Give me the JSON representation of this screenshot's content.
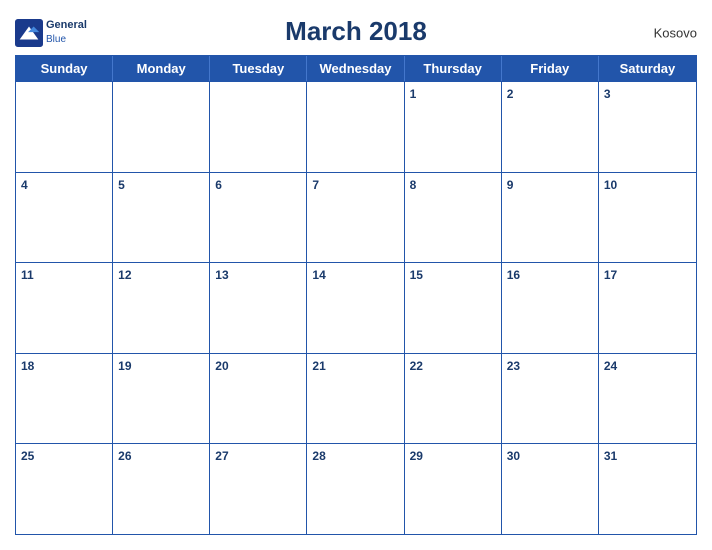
{
  "header": {
    "title": "March 2018",
    "country": "Kosovo",
    "logo": {
      "line1": "General",
      "line2": "Blue"
    }
  },
  "days": {
    "headers": [
      "Sunday",
      "Monday",
      "Tuesday",
      "Wednesday",
      "Thursday",
      "Friday",
      "Saturday"
    ]
  },
  "weeks": [
    [
      {
        "date": "",
        "empty": true
      },
      {
        "date": "",
        "empty": true
      },
      {
        "date": "",
        "empty": true
      },
      {
        "date": "",
        "empty": true
      },
      {
        "date": "1"
      },
      {
        "date": "2"
      },
      {
        "date": "3"
      }
    ],
    [
      {
        "date": "4"
      },
      {
        "date": "5"
      },
      {
        "date": "6"
      },
      {
        "date": "7"
      },
      {
        "date": "8"
      },
      {
        "date": "9"
      },
      {
        "date": "10"
      }
    ],
    [
      {
        "date": "11"
      },
      {
        "date": "12"
      },
      {
        "date": "13"
      },
      {
        "date": "14"
      },
      {
        "date": "15"
      },
      {
        "date": "16"
      },
      {
        "date": "17"
      }
    ],
    [
      {
        "date": "18"
      },
      {
        "date": "19"
      },
      {
        "date": "20"
      },
      {
        "date": "21"
      },
      {
        "date": "22"
      },
      {
        "date": "23"
      },
      {
        "date": "24"
      }
    ],
    [
      {
        "date": "25"
      },
      {
        "date": "26"
      },
      {
        "date": "27"
      },
      {
        "date": "28"
      },
      {
        "date": "29"
      },
      {
        "date": "30"
      },
      {
        "date": "31"
      }
    ]
  ]
}
